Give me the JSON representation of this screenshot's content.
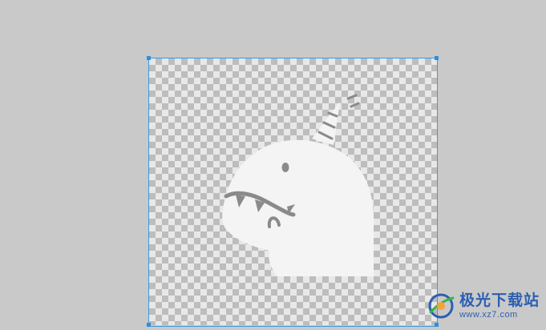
{
  "canvas": {
    "background_color": "#c9c9c9",
    "selection_color": "#3a9be0",
    "artboard_pattern": "transparency-checkerboard"
  },
  "image_layer": {
    "icon": "dinosaur-party-hat-icon",
    "fill_color": "#f4f4f4",
    "stroke_color": "#8a8a8a"
  },
  "watermark": {
    "site_name": "极光下载站",
    "url": "www.xz7.com",
    "brand_color": "#2c5fb0"
  }
}
